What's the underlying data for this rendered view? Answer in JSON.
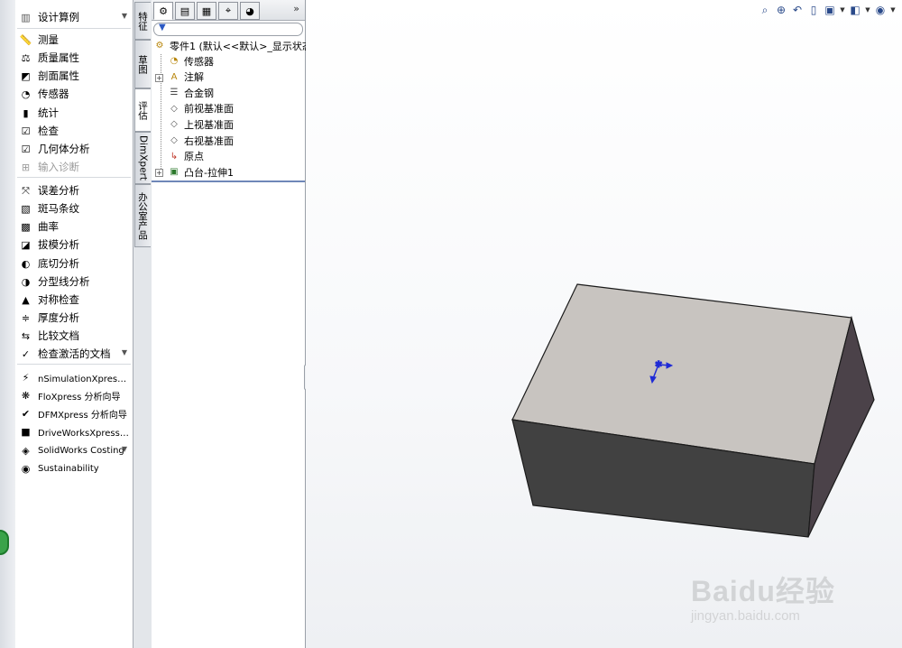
{
  "command_panel": {
    "header": "设计算例",
    "items": [
      {
        "label": "测量",
        "icon": "ruler-icon",
        "glyph": "📏",
        "enabled": true
      },
      {
        "label": "质量属性",
        "icon": "mass-properties-icon",
        "glyph": "⚖",
        "enabled": true
      },
      {
        "label": "剖面属性",
        "icon": "section-properties-icon",
        "glyph": "◩",
        "enabled": true
      },
      {
        "label": "传感器",
        "icon": "sensor-icon",
        "glyph": "◔",
        "enabled": true
      },
      {
        "label": "统计",
        "icon": "statistics-icon",
        "glyph": "▮",
        "enabled": true
      },
      {
        "label": "检查",
        "icon": "check-icon",
        "glyph": "☑",
        "enabled": true
      },
      {
        "label": "几何体分析",
        "icon": "geometry-analysis-icon",
        "glyph": "☑",
        "enabled": true
      },
      {
        "label": "输入诊断",
        "icon": "import-diagnostics-icon",
        "glyph": "⊞",
        "enabled": false
      },
      {
        "label": "误差分析",
        "icon": "deviation-analysis-icon",
        "glyph": "⤧",
        "enabled": true
      },
      {
        "label": "斑马条纹",
        "icon": "zebra-stripes-icon",
        "glyph": "▧",
        "enabled": true
      },
      {
        "label": "曲率",
        "icon": "curvature-icon",
        "glyph": "▩",
        "enabled": true
      },
      {
        "label": "拔模分析",
        "icon": "draft-analysis-icon",
        "glyph": "◪",
        "enabled": true
      },
      {
        "label": "底切分析",
        "icon": "undercut-analysis-icon",
        "glyph": "◐",
        "enabled": true
      },
      {
        "label": "分型线分析",
        "icon": "parting-line-analysis-icon",
        "glyph": "◑",
        "enabled": true
      },
      {
        "label": "对称检查",
        "icon": "symmetry-check-icon",
        "glyph": "▲",
        "enabled": true
      },
      {
        "label": "厚度分析",
        "icon": "thickness-analysis-icon",
        "glyph": "≑",
        "enabled": true
      },
      {
        "label": "比较文档",
        "icon": "compare-documents-icon",
        "glyph": "⇆",
        "enabled": true
      },
      {
        "label": "检查激活的文档",
        "icon": "check-active-document-icon",
        "glyph": "✓",
        "enabled": true
      },
      {
        "label": "nSimulationXpress 分…",
        "icon": "simulationxpress-icon",
        "glyph": "⚡",
        "enabled": true
      },
      {
        "label": "FloXpress 分析向导",
        "icon": "floxpress-icon",
        "glyph": "❋",
        "enabled": true
      },
      {
        "label": "DFMXpress 分析向导",
        "icon": "dfmxpress-icon",
        "glyph": "✔",
        "enabled": true
      },
      {
        "label": "DriveWorksXpress 向导",
        "icon": "driveworksxpress-icon",
        "glyph": "■",
        "enabled": true
      },
      {
        "label": "SolidWorks Costing",
        "icon": "costing-icon",
        "glyph": "◈",
        "enabled": true
      },
      {
        "label": "Sustainability",
        "icon": "sustainability-icon",
        "glyph": "◉",
        "enabled": true
      }
    ]
  },
  "side_tabs": [
    {
      "label": "特征",
      "active": false
    },
    {
      "label": "草图",
      "active": false
    },
    {
      "label": "评估",
      "active": true
    },
    {
      "label": "DimXpert",
      "active": false
    },
    {
      "label": "办公室产品",
      "active": false
    }
  ],
  "feature_tree": {
    "tabs": [
      {
        "icon": "feature-manager-icon",
        "glyph": "⚙",
        "active": true
      },
      {
        "icon": "property-manager-icon",
        "glyph": "▤",
        "active": false
      },
      {
        "icon": "configuration-manager-icon",
        "glyph": "▦",
        "active": false
      },
      {
        "icon": "dimxpert-manager-icon",
        "glyph": "⌖",
        "active": false
      },
      {
        "icon": "display-manager-icon",
        "glyph": "◕",
        "active": false
      }
    ],
    "more_label": "»",
    "root": "零件1 (默认<<默认>_显示状态",
    "nodes": [
      {
        "label": "传感器",
        "icon": "sensor-folder-icon",
        "glyph": "◔",
        "expandable": false
      },
      {
        "label": "注解",
        "icon": "annotations-icon",
        "glyph": "A",
        "expandable": true
      },
      {
        "label": "合金钢",
        "icon": "material-icon",
        "glyph": "☰",
        "expandable": false
      },
      {
        "label": "前视基准面",
        "icon": "front-plane-icon",
        "glyph": "◇",
        "expandable": false
      },
      {
        "label": "上视基准面",
        "icon": "top-plane-icon",
        "glyph": "◇",
        "expandable": false
      },
      {
        "label": "右视基准面",
        "icon": "right-plane-icon",
        "glyph": "◇",
        "expandable": false
      },
      {
        "label": "原点",
        "icon": "origin-icon",
        "glyph": "↳",
        "expandable": false
      },
      {
        "label": "凸台-拉伸1",
        "icon": "boss-extrude-icon",
        "glyph": "▣",
        "expandable": true
      }
    ]
  },
  "view_toolbar": [
    {
      "icon": "zoom-to-fit-icon",
      "glyph": "⌕"
    },
    {
      "icon": "zoom-to-area-icon",
      "glyph": "⊕"
    },
    {
      "icon": "previous-view-icon",
      "glyph": "↶"
    },
    {
      "icon": "section-view-icon",
      "glyph": "▯"
    },
    {
      "icon": "view-orientation-icon",
      "glyph": "▣"
    },
    {
      "icon": "display-style-icon",
      "glyph": "◧"
    },
    {
      "icon": "hide-show-items-icon",
      "glyph": "◉"
    }
  ],
  "watermark": {
    "main": "Baidu经验",
    "sub": "jingyan.baidu.com"
  },
  "colors": {
    "top_face": "#c8c4c0",
    "front_face": "#414141",
    "side_face": "#4b4249",
    "edge": "#1a1a1a",
    "triad": "#1f2bd6"
  }
}
